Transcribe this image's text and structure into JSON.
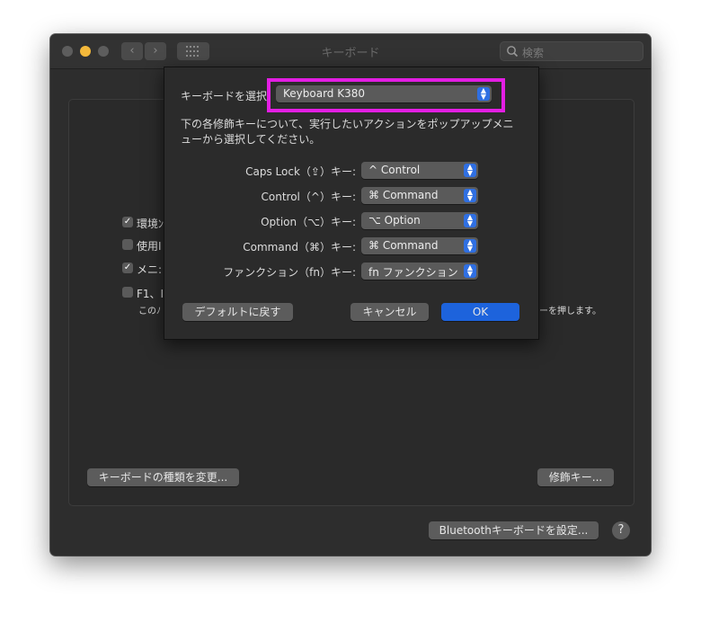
{
  "window": {
    "title": "キーボード"
  },
  "search": {
    "placeholder": "検索"
  },
  "background": {
    "checkbox_rows": [
      {
        "label": "環境ﾝ",
        "checked": true
      },
      {
        "label": "使用I",
        "checked": false
      },
      {
        "label": "メニ:",
        "checked": true
      },
      {
        "label": "F1、I",
        "checked": false
      }
    ],
    "note_left": "このﾉ",
    "note_right": "ーを押します。",
    "change_type_button": "キーボードの種類を変更...",
    "modifier_button": "修飾キー...",
    "bluetooth_button": "Bluetoothキーボードを設定...",
    "help_label": "?"
  },
  "sheet": {
    "keyboard_label": "キーボードを選択:",
    "keyboard_value": "Keyboard K380",
    "description": [
      "下の各修飾キーについて、実行したいアクションをポップアップメニ",
      "ューから選択してください。"
    ],
    "mappings": [
      {
        "label": "Caps Lock（⇪）キー:",
        "value": "^ Control"
      },
      {
        "label": "Control（^）キー:",
        "value": "⌘ Command"
      },
      {
        "label": "Option（⌥）キー:",
        "value": "⌥ Option"
      },
      {
        "label": "Command（⌘）キー:",
        "value": "⌘ Command"
      },
      {
        "label": "ファンクション（fn）キー:",
        "value": "fn ファンクション"
      }
    ],
    "default_button": "デフォルトに戻す",
    "cancel_button": "キャンセル",
    "ok_button": "OK"
  },
  "colors": {
    "highlight": "#e31ee3",
    "accent": "#1d63dc"
  }
}
